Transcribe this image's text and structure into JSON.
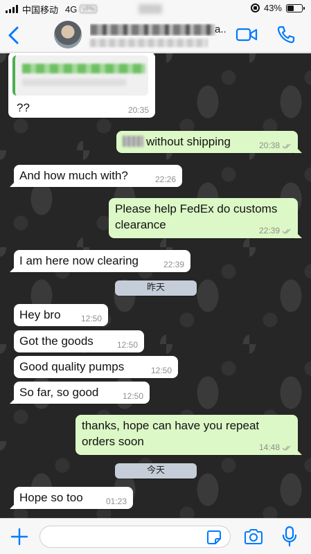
{
  "status_bar": {
    "carrier": "中国移动",
    "network": "4G",
    "vpn": "VPN",
    "battery": "43%",
    "battery_level": 0.43
  },
  "header": {
    "contact_name_suffix": "a...",
    "accent_color": "#007aff"
  },
  "messages": [
    {
      "id": "m1",
      "direction": "in",
      "text": "??",
      "time": "20:35",
      "has_quote": true
    },
    {
      "id": "m2",
      "direction": "out",
      "text": "without shipping",
      "time": "20:38",
      "has_blurred_price": true
    },
    {
      "id": "m3",
      "direction": "in",
      "text": "And how much with?",
      "time": "22:26"
    },
    {
      "id": "m4",
      "direction": "out",
      "text": "Please help FedEx do customs clearance",
      "time": "22:39"
    },
    {
      "id": "m5",
      "direction": "in",
      "text": "I am here now clearing",
      "time": "22:39"
    },
    {
      "id": "m6",
      "direction": "in",
      "text": "Hey bro",
      "time": "12:50"
    },
    {
      "id": "m7",
      "direction": "in",
      "text": "Got the goods",
      "time": "12:50"
    },
    {
      "id": "m8",
      "direction": "in",
      "text": "Good quality pumps",
      "time": "12:50"
    },
    {
      "id": "m9",
      "direction": "in",
      "text": "So far, so good",
      "time": "12:50"
    },
    {
      "id": "m10",
      "direction": "out",
      "text": "thanks, hope can have you repeat orders soon",
      "time": "14:48"
    },
    {
      "id": "m11",
      "direction": "in",
      "text": "Hope so too",
      "time": "01:23"
    }
  ],
  "date_separators": [
    "昨天",
    "今天"
  ],
  "composer": {
    "placeholder": ""
  },
  "colors": {
    "outgoing_bubble": "#dcf8c6",
    "incoming_bubble": "#ffffff",
    "date_chip": "#c5ced8",
    "icon_blue": "#007aff"
  },
  "icons": [
    "back-chevron-icon",
    "video-call-icon",
    "phone-call-icon",
    "plus-icon",
    "sticker-icon",
    "camera-icon",
    "microphone-icon"
  ]
}
